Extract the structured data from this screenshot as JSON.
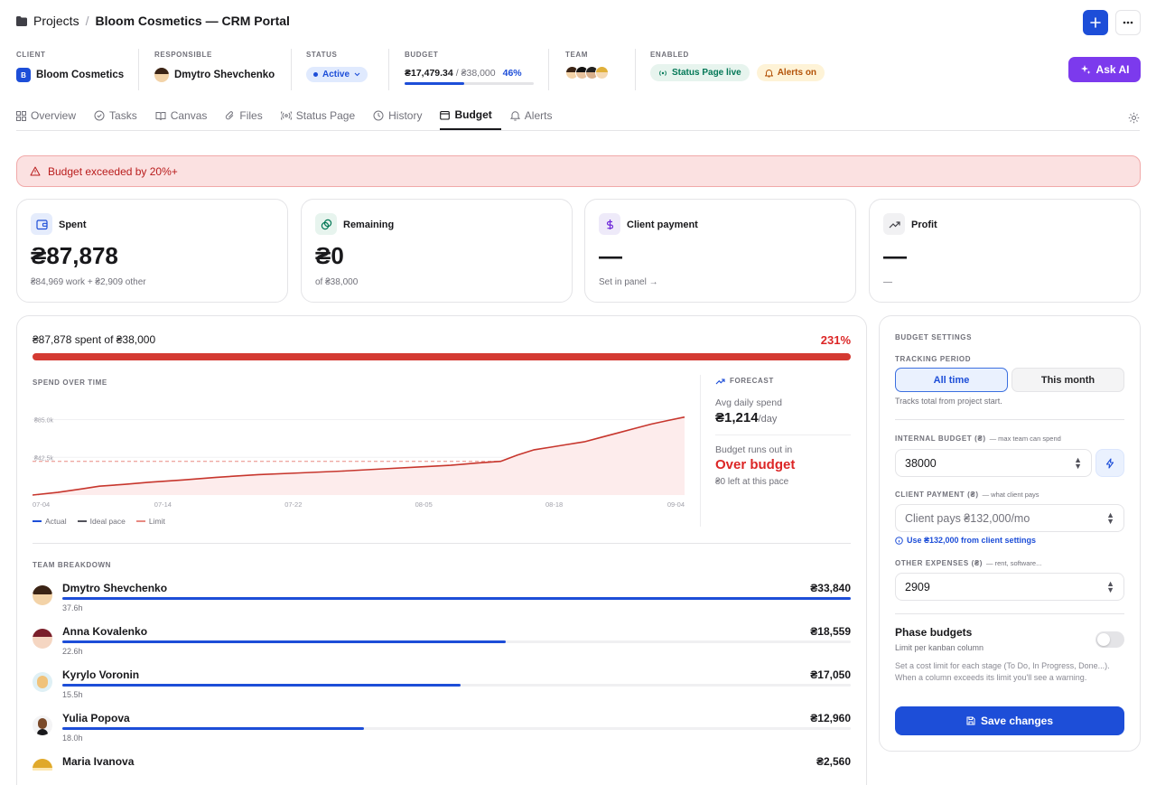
{
  "header": {
    "breadcrumb_root": "Projects",
    "breadcrumb_sep": "/",
    "project_title": "Bloom Cosmetics — CRM Portal",
    "ask_ai": "Ask AI"
  },
  "meta": {
    "client": {
      "label": "CLIENT",
      "badge": "B",
      "name": "Bloom Cosmetics"
    },
    "responsible": {
      "label": "RESPONSIBLE",
      "name": "Dmytro Shevchenko"
    },
    "status": {
      "label": "STATUS",
      "value": "Active"
    },
    "budget": {
      "label": "BUDGET",
      "spent": "₴17,479.34",
      "sep": "/",
      "total": "₴38,000",
      "percent": "46%",
      "progress": 0.46
    },
    "team": {
      "label": "TEAM"
    },
    "enabled": {
      "label": "ENABLED",
      "status_page": "Status Page live",
      "alerts": "Alerts on"
    }
  },
  "tabs": [
    {
      "label": "Overview"
    },
    {
      "label": "Tasks"
    },
    {
      "label": "Canvas"
    },
    {
      "label": "Files"
    },
    {
      "label": "Status Page"
    },
    {
      "label": "History"
    },
    {
      "label": "Budget"
    },
    {
      "label": "Alerts"
    }
  ],
  "alert": {
    "text": "Budget exceeded by 20%+"
  },
  "stats": [
    {
      "title": "Spent",
      "value": "₴87,878",
      "sub": "₴84,969 work + ₴2,909 other"
    },
    {
      "title": "Remaining",
      "value": "₴0",
      "sub": "of ₴38,000"
    },
    {
      "title": "Client payment",
      "value": "—",
      "sub": "Set in panel →"
    },
    {
      "title": "Profit",
      "value": "—",
      "sub": "—"
    }
  ],
  "overview": {
    "spent_line": "₴87,878 spent of ₴38,000",
    "percent": "231%",
    "progress": 1.0
  },
  "chart_data": {
    "type": "line",
    "title": "SPEND OVER TIME",
    "x_ticks": [
      "07-04",
      "07-14",
      "07-22",
      "08-05",
      "08-18",
      "09-04"
    ],
    "y_ticks": [
      "₴85.0k",
      "₴42.5k"
    ],
    "ylim": [
      0,
      110000
    ],
    "limit": 38000,
    "series": [
      {
        "name": "Actual",
        "points": [
          [
            0,
            0
          ],
          [
            3,
            3000
          ],
          [
            6,
            7000
          ],
          [
            8,
            10000
          ],
          [
            11,
            12000
          ],
          [
            14,
            14500
          ],
          [
            18,
            17000
          ],
          [
            22,
            20000
          ],
          [
            27,
            23000
          ],
          [
            32,
            25000
          ],
          [
            37,
            27000
          ],
          [
            42,
            29500
          ],
          [
            47,
            32000
          ],
          [
            50,
            33500
          ],
          [
            53,
            36000
          ],
          [
            56,
            38000
          ],
          [
            58,
            45000
          ],
          [
            60,
            51000
          ],
          [
            62,
            54000
          ],
          [
            64,
            57000
          ],
          [
            66,
            60000
          ],
          [
            68,
            65000
          ],
          [
            70,
            70000
          ],
          [
            72,
            75000
          ],
          [
            74,
            80000
          ],
          [
            76,
            84000
          ],
          [
            78,
            87878
          ]
        ]
      }
    ],
    "legend": [
      "Actual",
      "Ideal pace",
      "Limit"
    ],
    "x_count": 78
  },
  "forecast": {
    "title": "FORECAST",
    "avg_label": "Avg daily spend",
    "avg_value": "₴1,214",
    "avg_unit": "/day",
    "runout_label": "Budget runs out in",
    "runout_value": "Over budget",
    "runout_sub": "₴0 left at this pace"
  },
  "team_breakdown": {
    "title": "TEAM BREAKDOWN",
    "members": [
      {
        "name": "Dmytro Shevchenko",
        "hours": "37.6h",
        "amount": "₴33,840",
        "share": 1.0
      },
      {
        "name": "Anna Kovalenko",
        "hours": "22.6h",
        "amount": "₴18,559",
        "share": 0.563
      },
      {
        "name": "Kyrylo Voronin",
        "hours": "15.5h",
        "amount": "₴17,050",
        "share": 0.505
      },
      {
        "name": "Yulia Popova",
        "hours": "18.0h",
        "amount": "₴12,960",
        "share": 0.383
      },
      {
        "name": "Maria Ivanova",
        "hours": "",
        "amount": "₴2,560",
        "share": 0.076
      }
    ]
  },
  "settings": {
    "title": "BUDGET SETTINGS",
    "tracking_label": "TRACKING PERIOD",
    "period_all": "All time",
    "period_month": "This month",
    "tracking_hint": "Tracks total from project start.",
    "internal_label": "INTERNAL BUDGET (₴)",
    "internal_hint": "— max team can spend",
    "internal_value": "38000",
    "client_label": "CLIENT PAYMENT (₴)",
    "client_hint": "— what client pays",
    "client_placeholder": "Client pays ₴132,000/mo",
    "client_link": "Use ₴132,000 from client settings",
    "other_label": "OTHER EXPENSES (₴)",
    "other_hint": "— rent, software...",
    "other_value": "2909",
    "phase_title": "Phase budgets",
    "phase_sub": "Limit per kanban column",
    "phase_desc": "Set a cost limit for each stage (To Do, In Progress, Done...). When a column exceeds its limit you'll see a warning.",
    "save": "Save changes"
  },
  "colors": {
    "accent": "#1d4ed8",
    "danger": "#dc2626",
    "ai": "#7c3aed"
  }
}
